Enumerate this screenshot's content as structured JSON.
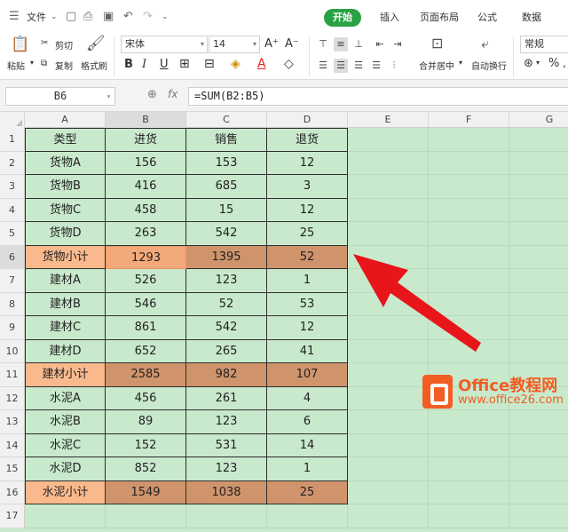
{
  "menu": {
    "file_label": "文件",
    "tabs": [
      "开始",
      "插入",
      "页面布局",
      "公式",
      "数据"
    ]
  },
  "ribbon": {
    "paste": "粘贴",
    "cut": "剪切",
    "copy": "复制",
    "format_painter": "格式刷",
    "font_name": "宋体",
    "font_size": "14",
    "merge_center": "合并居中",
    "wrap_text": "自动换行",
    "number_format": "常规"
  },
  "formula_bar": {
    "cell_ref": "B6",
    "fx": "fx",
    "formula": "=SUM(B2:B5)"
  },
  "columns": [
    "A",
    "B",
    "C",
    "D",
    "E",
    "F",
    "G"
  ],
  "row_numbers": [
    "1",
    "2",
    "3",
    "4",
    "5",
    "6",
    "7",
    "8",
    "9",
    "10",
    "11",
    "12",
    "13",
    "14",
    "15",
    "16",
    "17"
  ],
  "table": {
    "headers": [
      "类型",
      "进货",
      "销售",
      "退货"
    ],
    "rows": [
      [
        "货物A",
        "156",
        "153",
        "12"
      ],
      [
        "货物B",
        "416",
        "685",
        "3"
      ],
      [
        "货物C",
        "458",
        "15",
        "12"
      ],
      [
        "货物D",
        "263",
        "542",
        "25"
      ],
      [
        "货物小计",
        "1293",
        "1395",
        "52"
      ],
      [
        "建材A",
        "526",
        "123",
        "1"
      ],
      [
        "建材B",
        "546",
        "52",
        "53"
      ],
      [
        "建材C",
        "861",
        "542",
        "12"
      ],
      [
        "建材D",
        "652",
        "265",
        "41"
      ],
      [
        "建材小计",
        "2585",
        "982",
        "107"
      ],
      [
        "水泥A",
        "456",
        "261",
        "4"
      ],
      [
        "水泥B",
        "89",
        "123",
        "6"
      ],
      [
        "水泥C",
        "152",
        "531",
        "14"
      ],
      [
        "水泥D",
        "852",
        "123",
        "1"
      ],
      [
        "水泥小计",
        "1549",
        "1038",
        "25"
      ]
    ]
  },
  "watermark": {
    "brand": "Office教程网",
    "url": "www.office26.com"
  },
  "colors": {
    "sheet_bg": "#c9e9cc",
    "subtotal_label": "#f9b98c",
    "subtotal_value": "#d0946c",
    "active_tab": "#2aa244",
    "arrow": "#e8151b"
  }
}
